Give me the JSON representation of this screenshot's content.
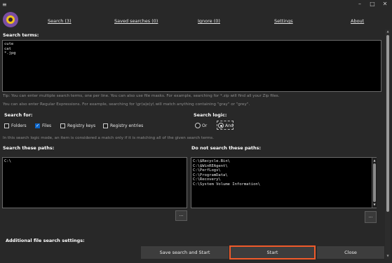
{
  "window": {
    "menu_glyph": "≡",
    "minimize_glyph": "–",
    "maximize_glyph": "□",
    "close_glyph": "✕"
  },
  "tabs": [
    "Search (3)",
    "Saved searches (0)",
    "Ignore (0)",
    "Settings",
    "About"
  ],
  "search_terms": {
    "label": "Search terms:",
    "value": "cute\ncat\n*.jpg"
  },
  "tips": {
    "line1": "Tip: You can enter multiple search terms, one per line. You can also use file masks. For example, searching for *.zip will find all your Zip files.",
    "line2": "You can also enter Regular Expressions. For example, searching for \\gr(a|e)y\\ will match anything containing \"gray\" or \"grey\"."
  },
  "search_for": {
    "label": "Search for:",
    "options": [
      {
        "label": "Folders",
        "checked": false
      },
      {
        "label": "Files",
        "checked": true
      },
      {
        "label": "Registry keys",
        "checked": false
      },
      {
        "label": "Registry entries",
        "checked": false
      }
    ]
  },
  "search_logic": {
    "label": "Search logic:",
    "options": [
      {
        "label": "Or",
        "selected": false
      },
      {
        "label": "And",
        "selected": true
      }
    ],
    "note": "In this search logic mode, an item is considered a match only if it is matching all of the given search terms."
  },
  "search_paths": {
    "label": "Search these paths:",
    "value": "C:\\",
    "browse_label": "..."
  },
  "exclude_paths": {
    "label": "Do not search these paths:",
    "value": "C:\\$Recycle.Bin\\\nC:\\$WinREAgent\\\nC:\\PerfLogs\\\nC:\\ProgramData\\\nC:\\Recovery\\\nC:\\System Volume Information\\",
    "browse_label": "..."
  },
  "additional": {
    "label": "Additional file search settings:"
  },
  "footer": {
    "save_start": "Save search and Start",
    "start": "Start",
    "close": "Close"
  },
  "colors": {
    "background": "#282828",
    "start_highlight": "#f05a2a",
    "checkbox_checked": "#0b63c5",
    "logo_purple": "#7a4ea3",
    "logo_yellow": "#f0c21a"
  }
}
